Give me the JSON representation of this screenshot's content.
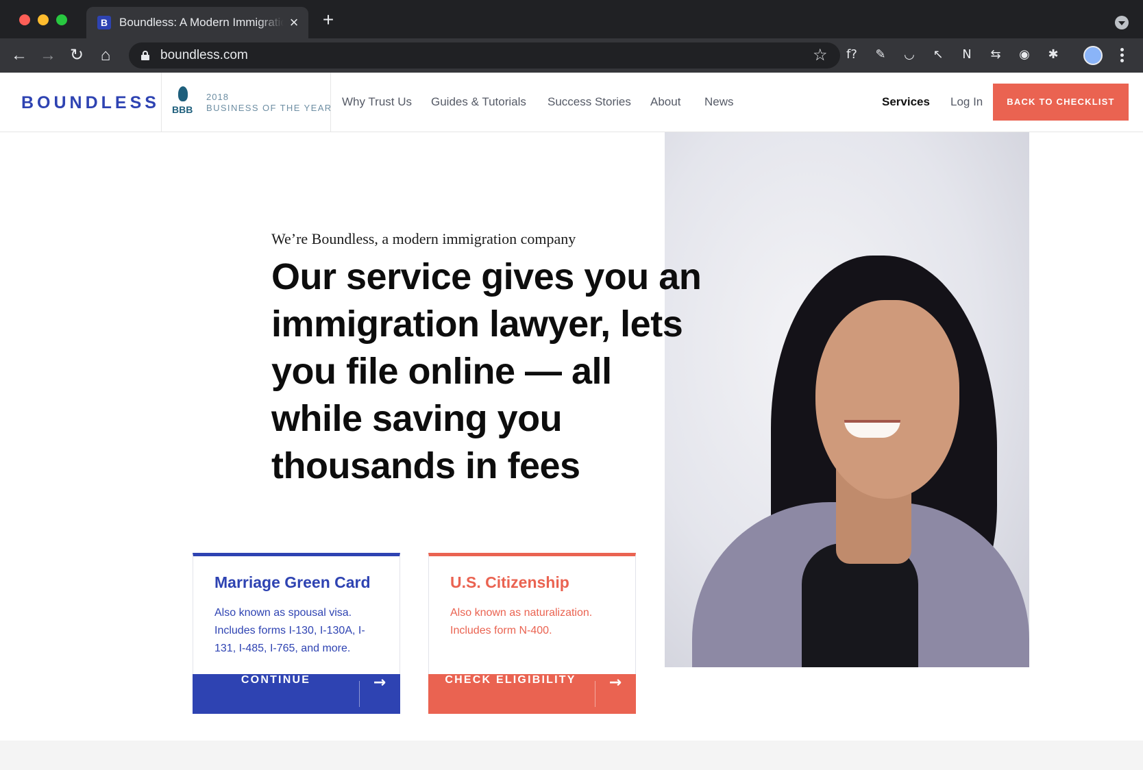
{
  "browser": {
    "tab_title": "Boundless: A Modern Immigration",
    "tab_favicon_letter": "B",
    "url": "boundless.com",
    "icons": {
      "back": "←",
      "forward": "→",
      "reload": "↻",
      "home": "⌂",
      "star": "☆",
      "close": "×",
      "new_tab": "+"
    },
    "extensions": [
      {
        "name": "font-ninja-icon",
        "glyph": "f?"
      },
      {
        "name": "pen-tool-icon",
        "glyph": "✎"
      },
      {
        "name": "smile-extension-icon",
        "glyph": "◡"
      },
      {
        "name": "cursor-extension-icon",
        "glyph": "↖"
      },
      {
        "name": "notion-icon",
        "glyph": "N"
      },
      {
        "name": "link-extension-icon",
        "glyph": "⇆"
      },
      {
        "name": "camera-icon",
        "glyph": "◉"
      },
      {
        "name": "puzzle-icon",
        "glyph": "✱"
      }
    ]
  },
  "site": {
    "logo": "BOUNDLESS",
    "bbb": {
      "mark": "BBB",
      "year": "2018",
      "caption": "BUSINESS OF THE YEAR"
    },
    "nav": [
      {
        "label": "Why Trust Us"
      },
      {
        "label": "Guides & Tutorials"
      },
      {
        "label": "Success Stories"
      },
      {
        "label": "About"
      },
      {
        "label": "News"
      }
    ],
    "services_label": "Services",
    "login_label": "Log In",
    "cta_label": "BACK TO CHECKLIST"
  },
  "hero": {
    "eyebrow": "We’re Boundless, a modern immigration company",
    "headline": "Our service gives you an immigration lawyer, lets you file online — all while saving you thousands in fees"
  },
  "cards": [
    {
      "title": "Marriage Green Card",
      "description": "Also known as spousal visa. Includes forms I-130, I-130A, I-131, I-485, I-765, and more.",
      "button": "CONTINUE",
      "arrow": "→"
    },
    {
      "title": "U.S. Citizenship",
      "description": "Also known as naturalization. Includes form N-400.",
      "button": "CHECK ELIGIBILITY",
      "arrow": "→"
    }
  ],
  "colors": {
    "brand_blue": "#2e43b2",
    "brand_coral": "#ea6351",
    "chrome_dark": "#202124"
  }
}
